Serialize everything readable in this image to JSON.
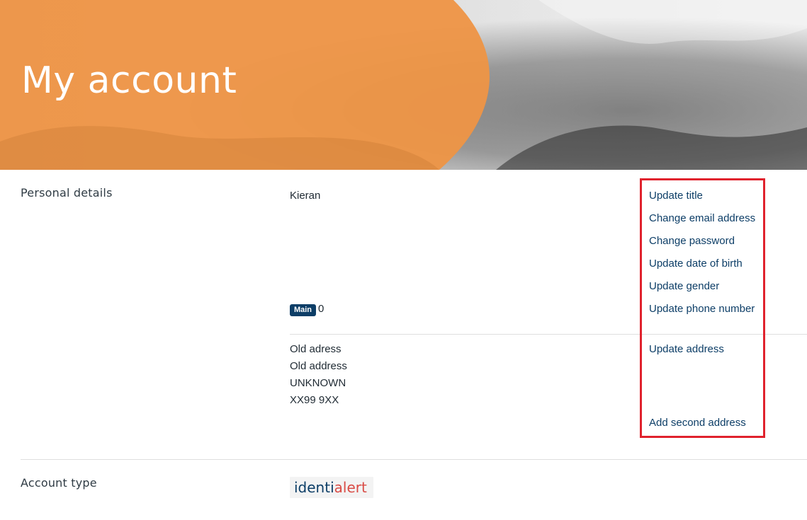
{
  "hero": {
    "title": "My account"
  },
  "personal_details": {
    "label": "Personal details",
    "name": "Kieran",
    "badge_label": "Main",
    "badge_value": "0",
    "links": {
      "update_title": "Update title",
      "change_email": "Change email address",
      "change_password": "Change password",
      "update_dob": "Update date of birth",
      "update_gender": "Update gender",
      "update_phone": "Update phone number"
    },
    "address": {
      "line1": "Old adress",
      "line2": "Old address",
      "line3": "UNKNOWN",
      "postcode": "XX99 9XX",
      "update_link": "Update address",
      "add_second_link": "Add second address"
    }
  },
  "account_type": {
    "label": "Account type",
    "logo_text_a": "identi",
    "logo_text_b": "alert"
  },
  "colors": {
    "brand_orange": "#ee9445",
    "link": "#0d3e67",
    "highlight": "#e0222d",
    "logo_red": "#d94b45"
  }
}
